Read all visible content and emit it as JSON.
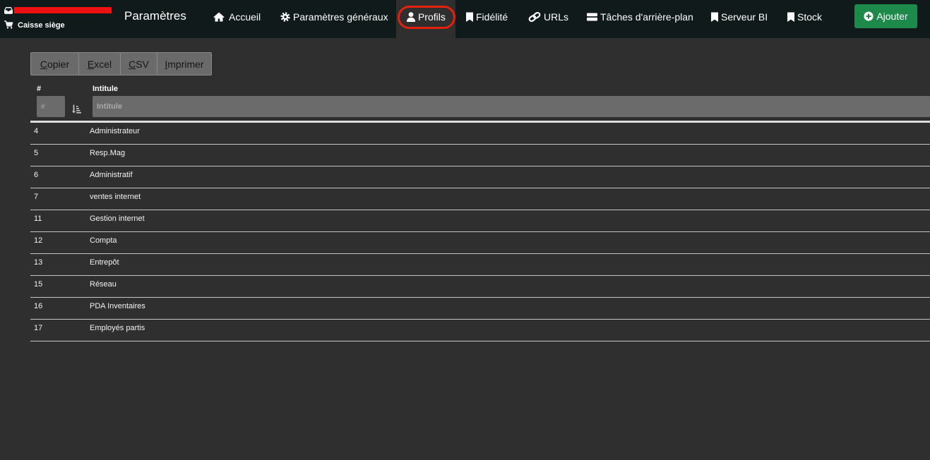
{
  "header": {
    "store_label": "Caisse siège",
    "brand": "Paramètres"
  },
  "nav": {
    "items": [
      {
        "label": "Accueil",
        "icon": "home-icon"
      },
      {
        "label": "Paramètres généraux",
        "icon": "gear-icon"
      },
      {
        "label": "Profils",
        "icon": "user-icon",
        "active": true
      },
      {
        "label": "Fidélité",
        "icon": "bookmark-icon"
      },
      {
        "label": "URLs",
        "icon": "link-icon"
      },
      {
        "label": "Tâches d'arrière-plan",
        "icon": "server-icon"
      },
      {
        "label": "Serveur BI",
        "icon": "bookmark-icon"
      },
      {
        "label": "Stock",
        "icon": "bookmark-icon"
      }
    ],
    "add_button": {
      "label": "Ajouter",
      "icon": "plus-circle-icon"
    }
  },
  "toolbar": {
    "buttons": [
      {
        "label": "Copier"
      },
      {
        "label": "Excel"
      },
      {
        "label": "CSV"
      },
      {
        "label": "Imprimer"
      }
    ]
  },
  "table": {
    "columns": [
      {
        "label": "#",
        "filter_placeholder": "#"
      },
      {
        "label": "Intitule",
        "filter_placeholder": "Intitule"
      }
    ],
    "sort_indicator_icon": "sort-amount-icon",
    "rows": [
      {
        "id": "4",
        "name": "Administrateur"
      },
      {
        "id": "5",
        "name": "Resp.Mag"
      },
      {
        "id": "6",
        "name": "Administratif"
      },
      {
        "id": "7",
        "name": "ventes internet"
      },
      {
        "id": "11",
        "name": "Gestion internet"
      },
      {
        "id": "12",
        "name": "Compta"
      },
      {
        "id": "13",
        "name": "Entrepôt"
      },
      {
        "id": "15",
        "name": "Réseau"
      },
      {
        "id": "16",
        "name": "PDA Inventaires"
      },
      {
        "id": "17",
        "name": "Employés partis"
      }
    ]
  },
  "colors": {
    "navbar_bg": "#101a1a",
    "page_bg": "#2f2f2f",
    "accent_green": "#1d8a4c",
    "annotation_red": "#e5200d",
    "redaction_red": "#ee1111"
  }
}
